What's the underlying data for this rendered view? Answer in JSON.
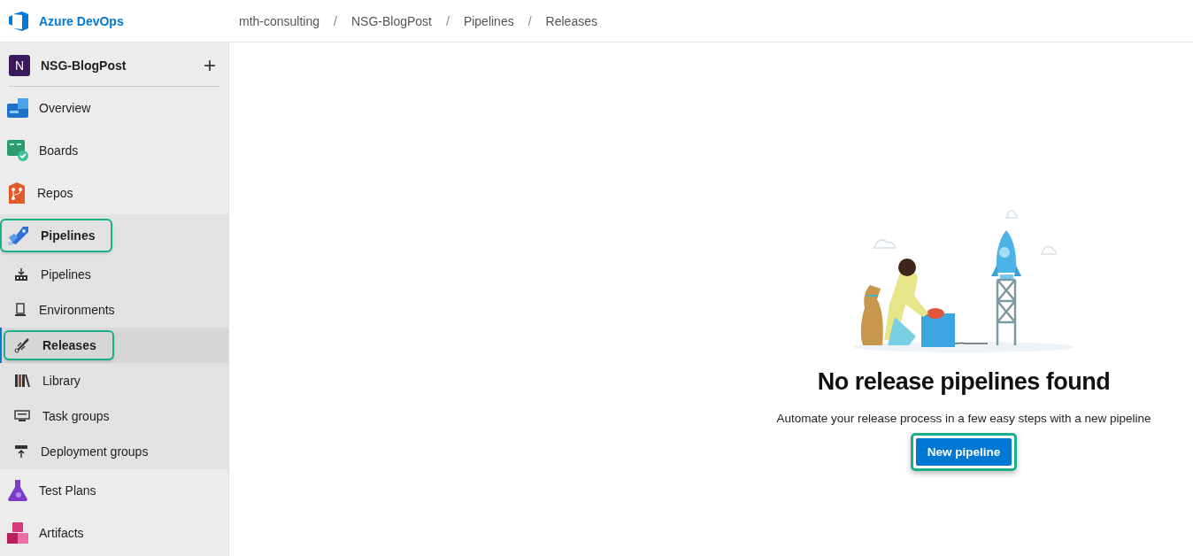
{
  "header": {
    "product": "Azure DevOps",
    "breadcrumbs": [
      "mth-consulting",
      "NSG-BlogPost",
      "Pipelines",
      "Releases"
    ],
    "separator": "/"
  },
  "project": {
    "initial": "N",
    "name": "NSG-BlogPost",
    "add": "+"
  },
  "nav": [
    {
      "label": "Overview",
      "kind": "overview",
      "selected": false,
      "highlighted": false
    },
    {
      "label": "Boards",
      "kind": "boards",
      "selected": false,
      "highlighted": false
    },
    {
      "label": "Repos",
      "kind": "repos",
      "selected": false,
      "highlighted": false
    },
    {
      "label": "Pipelines",
      "kind": "pipelines",
      "selected": false,
      "highlighted": true,
      "expanded": true,
      "children": [
        {
          "label": "Pipelines",
          "kind": "builds",
          "selected": false,
          "highlighted": false
        },
        {
          "label": "Environments",
          "kind": "environments",
          "selected": false,
          "highlighted": false
        },
        {
          "label": "Releases",
          "kind": "releases",
          "selected": true,
          "highlighted": true
        },
        {
          "label": "Library",
          "kind": "library",
          "selected": false,
          "highlighted": false
        },
        {
          "label": "Task groups",
          "kind": "taskgroups",
          "selected": false,
          "highlighted": false
        },
        {
          "label": "Deployment groups",
          "kind": "deploymentgroups",
          "selected": false,
          "highlighted": false
        }
      ]
    },
    {
      "label": "Test Plans",
      "kind": "testplans",
      "selected": false,
      "highlighted": false
    },
    {
      "label": "Artifacts",
      "kind": "artifacts",
      "selected": false,
      "highlighted": false
    }
  ],
  "empty_state": {
    "title": "No release pipelines found",
    "message": "Automate your release process in a few easy steps with a new pipeline",
    "button": {
      "label": "New pipeline",
      "highlighted": true
    }
  }
}
